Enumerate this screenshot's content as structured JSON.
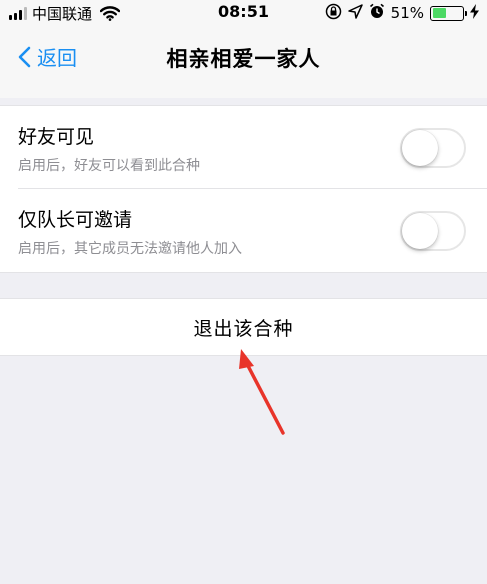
{
  "status_bar": {
    "carrier": "中国联通",
    "time": "08:51",
    "battery_percent": "51%",
    "battery_level": 0.51,
    "icons": [
      "signal-icon",
      "wifi-icon",
      "orientation-lock-icon",
      "location-icon",
      "alarm-icon",
      "battery-icon",
      "charging-icon"
    ]
  },
  "nav": {
    "back_label": "返回",
    "title": "相亲相爱一家人"
  },
  "settings": [
    {
      "title": "好友可见",
      "subtitle": "启用后，好友可以看到此合种",
      "enabled": false
    },
    {
      "title": "仅队长可邀请",
      "subtitle": "启用后，其它成员无法邀请他人加入",
      "enabled": false
    }
  ],
  "exit_button": {
    "label": "退出该合种"
  },
  "colors": {
    "accent": "#1a8ff2",
    "annotation_arrow": "#e8342a",
    "battery_fill": "#4cd964",
    "background": "#efeff4"
  }
}
